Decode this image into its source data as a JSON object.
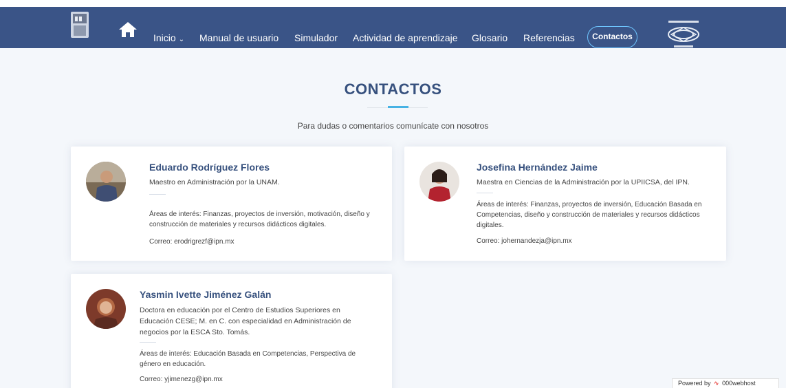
{
  "nav": {
    "items": [
      {
        "label": "Inicio",
        "has_dropdown": true
      },
      {
        "label": "Manual de usuario"
      },
      {
        "label": "Simulador"
      },
      {
        "label": "Actividad de aprendizaje"
      },
      {
        "label": "Glosario"
      },
      {
        "label": "Referencias"
      }
    ],
    "contact_label": "Contactos",
    "chevron": "⌄",
    "home_icon": "home-icon",
    "colors": {
      "bar": "#3a5487",
      "accent": "#6fc6ff"
    }
  },
  "page": {
    "title": "CONTACTOS",
    "subtitle": "Para dudas o comentarios comunícate con nosotros"
  },
  "contacts": [
    {
      "name": "Eduardo Rodríguez Flores",
      "role": "Maestro en Administración por la UNAM.",
      "areas": "Áreas de interés: Finanzas, proyectos de inversión, motivación, diseño y construcción de materiales y recursos didácticos digitales.",
      "email": "Correo: erodrigrezf@ipn.mx"
    },
    {
      "name": "Josefina Hernández Jaime",
      "role": "Maestra en Ciencias de la Administración por la UPIICSA, del IPN.",
      "areas": "Áreas de interés: Finanzas, proyectos de inversión, Educación Basada en Competencias, diseño y construcción de materiales y recursos didácticos digitales.",
      "email": "Correo: johernandezja@ipn.mx"
    },
    {
      "name": "Yasmin Ivette Jiménez Galán",
      "role": "Doctora en educación por el Centro de Estudios Superiores en Educación CESE; M. en C. con especialidad en Administración de negocios por la ESCA Sto. Tomás.",
      "areas": "Áreas de interés: Educación Basada en Competencias, Perspectiva de género en educación.",
      "email": "Correo: yjimenezg@ipn.mx"
    }
  ],
  "watermark": {
    "prefix": "Powered by",
    "brand": "000webhost"
  }
}
